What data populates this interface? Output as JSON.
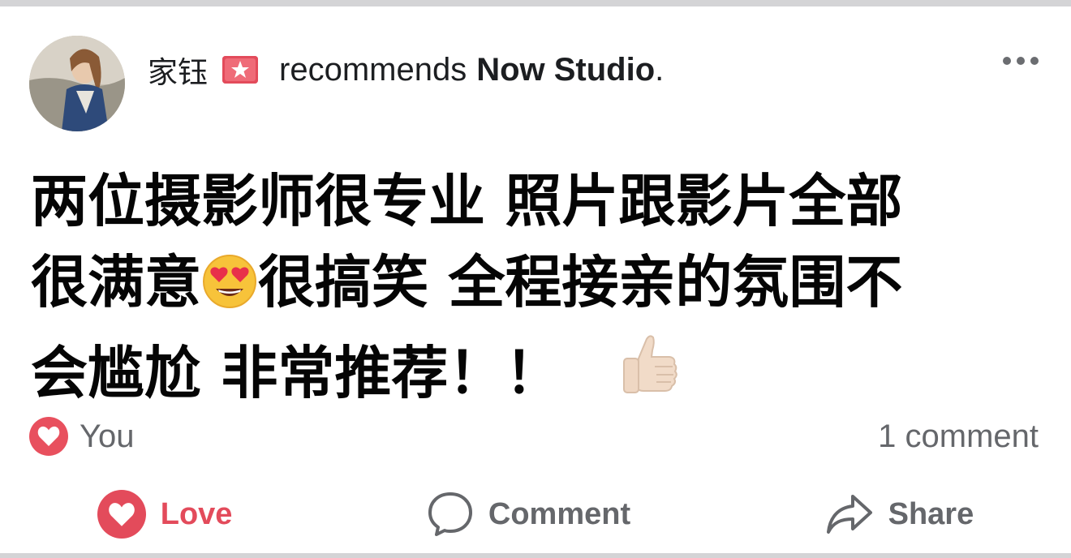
{
  "post": {
    "author": "家钰",
    "verb": "recommends",
    "page": "Now Studio",
    "period": ".",
    "text_lines": [
      "两位摄影师很专业 照片跟影片全部",
      "很满意",
      "很搞笑 全程接亲的氛围不",
      "会尴尬 非常推荐！！"
    ]
  },
  "reactions": {
    "who": "You",
    "comment_count": "1 comment"
  },
  "actions": {
    "love": "Love",
    "comment": "Comment",
    "share": "Share"
  },
  "icons": {
    "badge": "star-badge-icon",
    "reaction": "heart-icon",
    "emoji1": "heart-eyes-emoji",
    "emoji2": "thumbs-up-emoji"
  },
  "colors": {
    "love": "#e34b5b",
    "muted": "#65676b",
    "text": "#050505"
  }
}
